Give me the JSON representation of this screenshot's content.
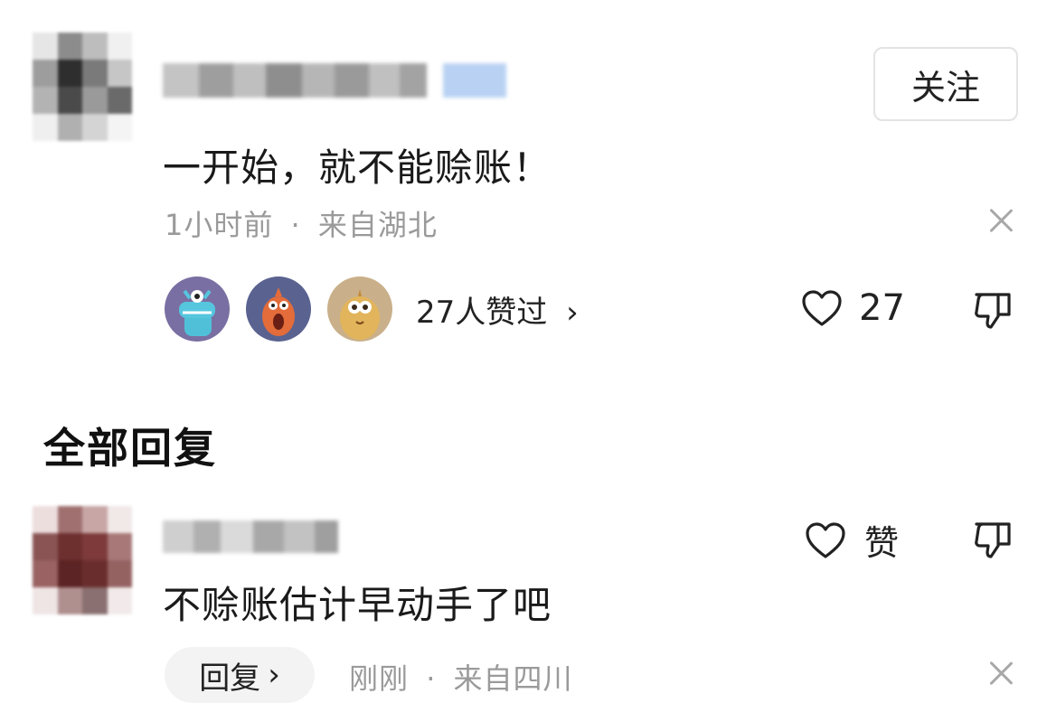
{
  "top_comment": {
    "follow_label": "关注",
    "text": "一开始，就不能赊账！",
    "time": "1小时前",
    "separator": "·",
    "location": "来自湖北",
    "likers_label": "27人赞过",
    "likers_chevron": "›",
    "like_count": "27"
  },
  "section": {
    "title": "全部回复"
  },
  "reply": {
    "like_label": "赞",
    "text": "不赊账估计早动手了吧",
    "reply_label": "回复",
    "reply_chevron": "›",
    "time": "刚刚",
    "separator": "·",
    "location": "来自四川"
  },
  "colors": {
    "text_primary": "#1a1a1a",
    "text_meta": "#9a9a9a",
    "liker1_bg": "#7a6fa2",
    "liker2_bg": "#5a6290",
    "liker3_bg": "#c9b08a"
  }
}
